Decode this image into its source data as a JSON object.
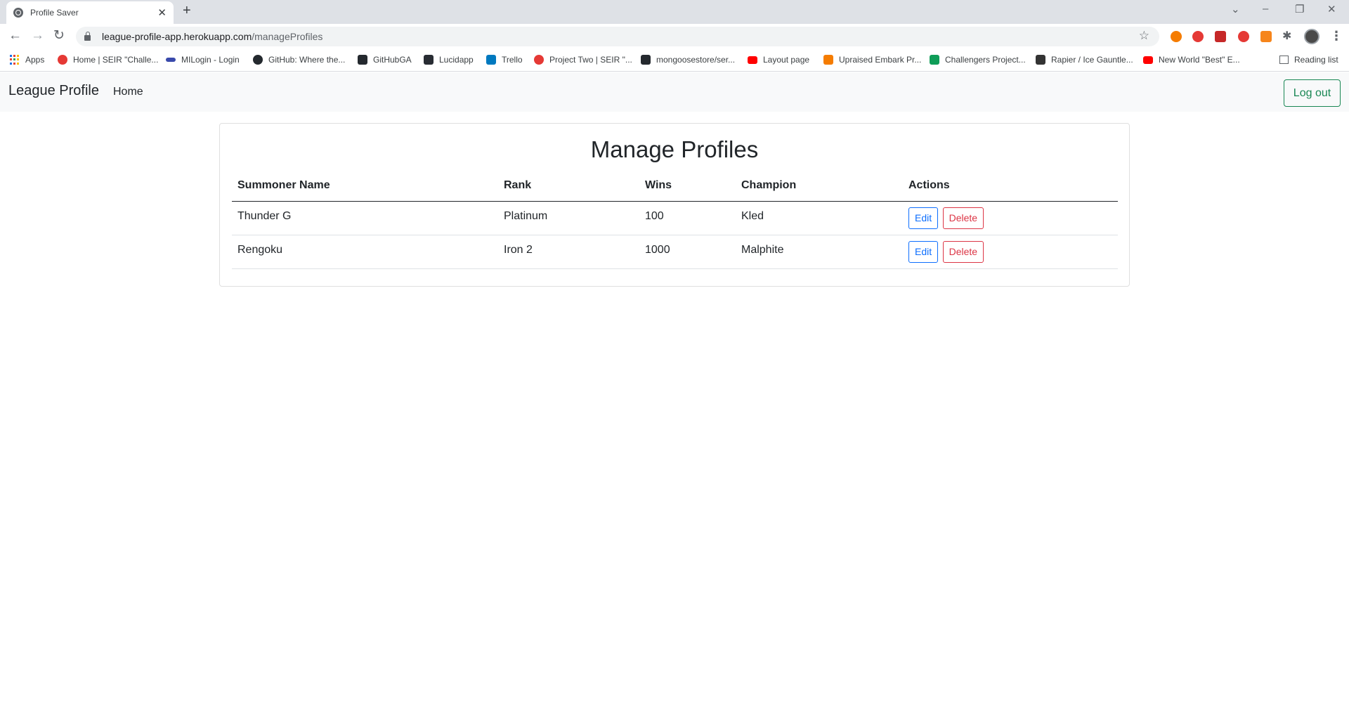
{
  "browser": {
    "tab_title": "Profile Saver",
    "url_host": "league-profile-app.herokuapp.com",
    "url_path": "/manageProfiles",
    "bookmarks": [
      {
        "label": "Apps",
        "color": "#1a73e8"
      },
      {
        "label": "Home | SEIR \"Challe...",
        "color": "#e53935"
      },
      {
        "label": "MILogin - Login",
        "color": "#3949ab"
      },
      {
        "label": "GitHub: Where the...",
        "color": "#24292e"
      },
      {
        "label": "GitHubGA",
        "color": "#24292e"
      },
      {
        "label": "Lucidapp",
        "color": "#282c33"
      },
      {
        "label": "Trello",
        "color": "#0079bf"
      },
      {
        "label": "Project Two | SEIR \"...",
        "color": "#e53935"
      },
      {
        "label": "mongoosestore/ser...",
        "color": "#24292e"
      },
      {
        "label": "Layout page",
        "color": "#ff0000"
      },
      {
        "label": "Upraised Embark Pr...",
        "color": "#f57c00"
      },
      {
        "label": "Challengers Project...",
        "color": "#0f9d58"
      },
      {
        "label": "Rapier / Ice Gauntle...",
        "color": "#333333"
      },
      {
        "label": "New World \"Best\" E...",
        "color": "#ff0000"
      }
    ],
    "reading_list": "Reading list"
  },
  "app": {
    "brand": "League Profile",
    "nav_home": "Home",
    "logout_label": "Log out",
    "page_title": "Manage Profiles",
    "table": {
      "headers": [
        "Summoner Name",
        "Rank",
        "Wins",
        "Champion",
        "Actions"
      ],
      "rows": [
        {
          "name": "Thunder G",
          "rank": "Platinum",
          "wins": "100",
          "champion": "Kled"
        },
        {
          "name": "Rengoku",
          "rank": "Iron 2",
          "wins": "1000",
          "champion": "Malphite"
        }
      ],
      "edit_label": "Edit",
      "delete_label": "Delete"
    }
  },
  "colors": {
    "success": "#198754",
    "primary": "#0d6efd",
    "danger": "#dc3545"
  }
}
